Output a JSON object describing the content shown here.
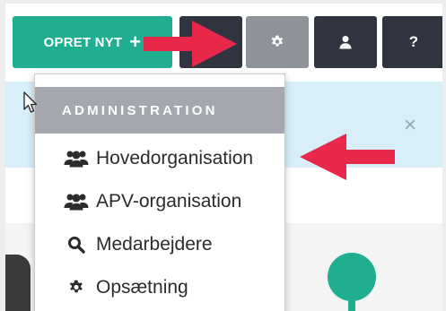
{
  "toolbar": {
    "create_label": "OPRET NYT",
    "create_plus": "+",
    "help_label": "?",
    "buttons": [
      {
        "name": "create-new-button",
        "bg": "#1fae8f"
      },
      {
        "name": "dark-button",
        "bg": "#2f3440"
      },
      {
        "name": "settings-button",
        "bg": "#8e9399",
        "icon": "gear-icon"
      },
      {
        "name": "user-button",
        "bg": "#2f3440",
        "icon": "user-icon"
      },
      {
        "name": "help-button",
        "bg": "#2f3440"
      }
    ]
  },
  "dropdown": {
    "header": "ADMINISTRATION",
    "items": [
      {
        "label": "Hovedorganisation",
        "icon": "users-icon"
      },
      {
        "label": "APV-organisation",
        "icon": "users-icon"
      },
      {
        "label": "Medarbejdere",
        "icon": "search-icon"
      },
      {
        "label": "Opsætning",
        "icon": "gear-icon"
      }
    ]
  },
  "banner": {
    "close": "×"
  },
  "colors": {
    "accent": "#1fae8f",
    "dark": "#2f3440",
    "annotation_arrow": "#e8284b",
    "header_gray": "#a4a7ae",
    "banner_bg": "#d8eef8"
  }
}
